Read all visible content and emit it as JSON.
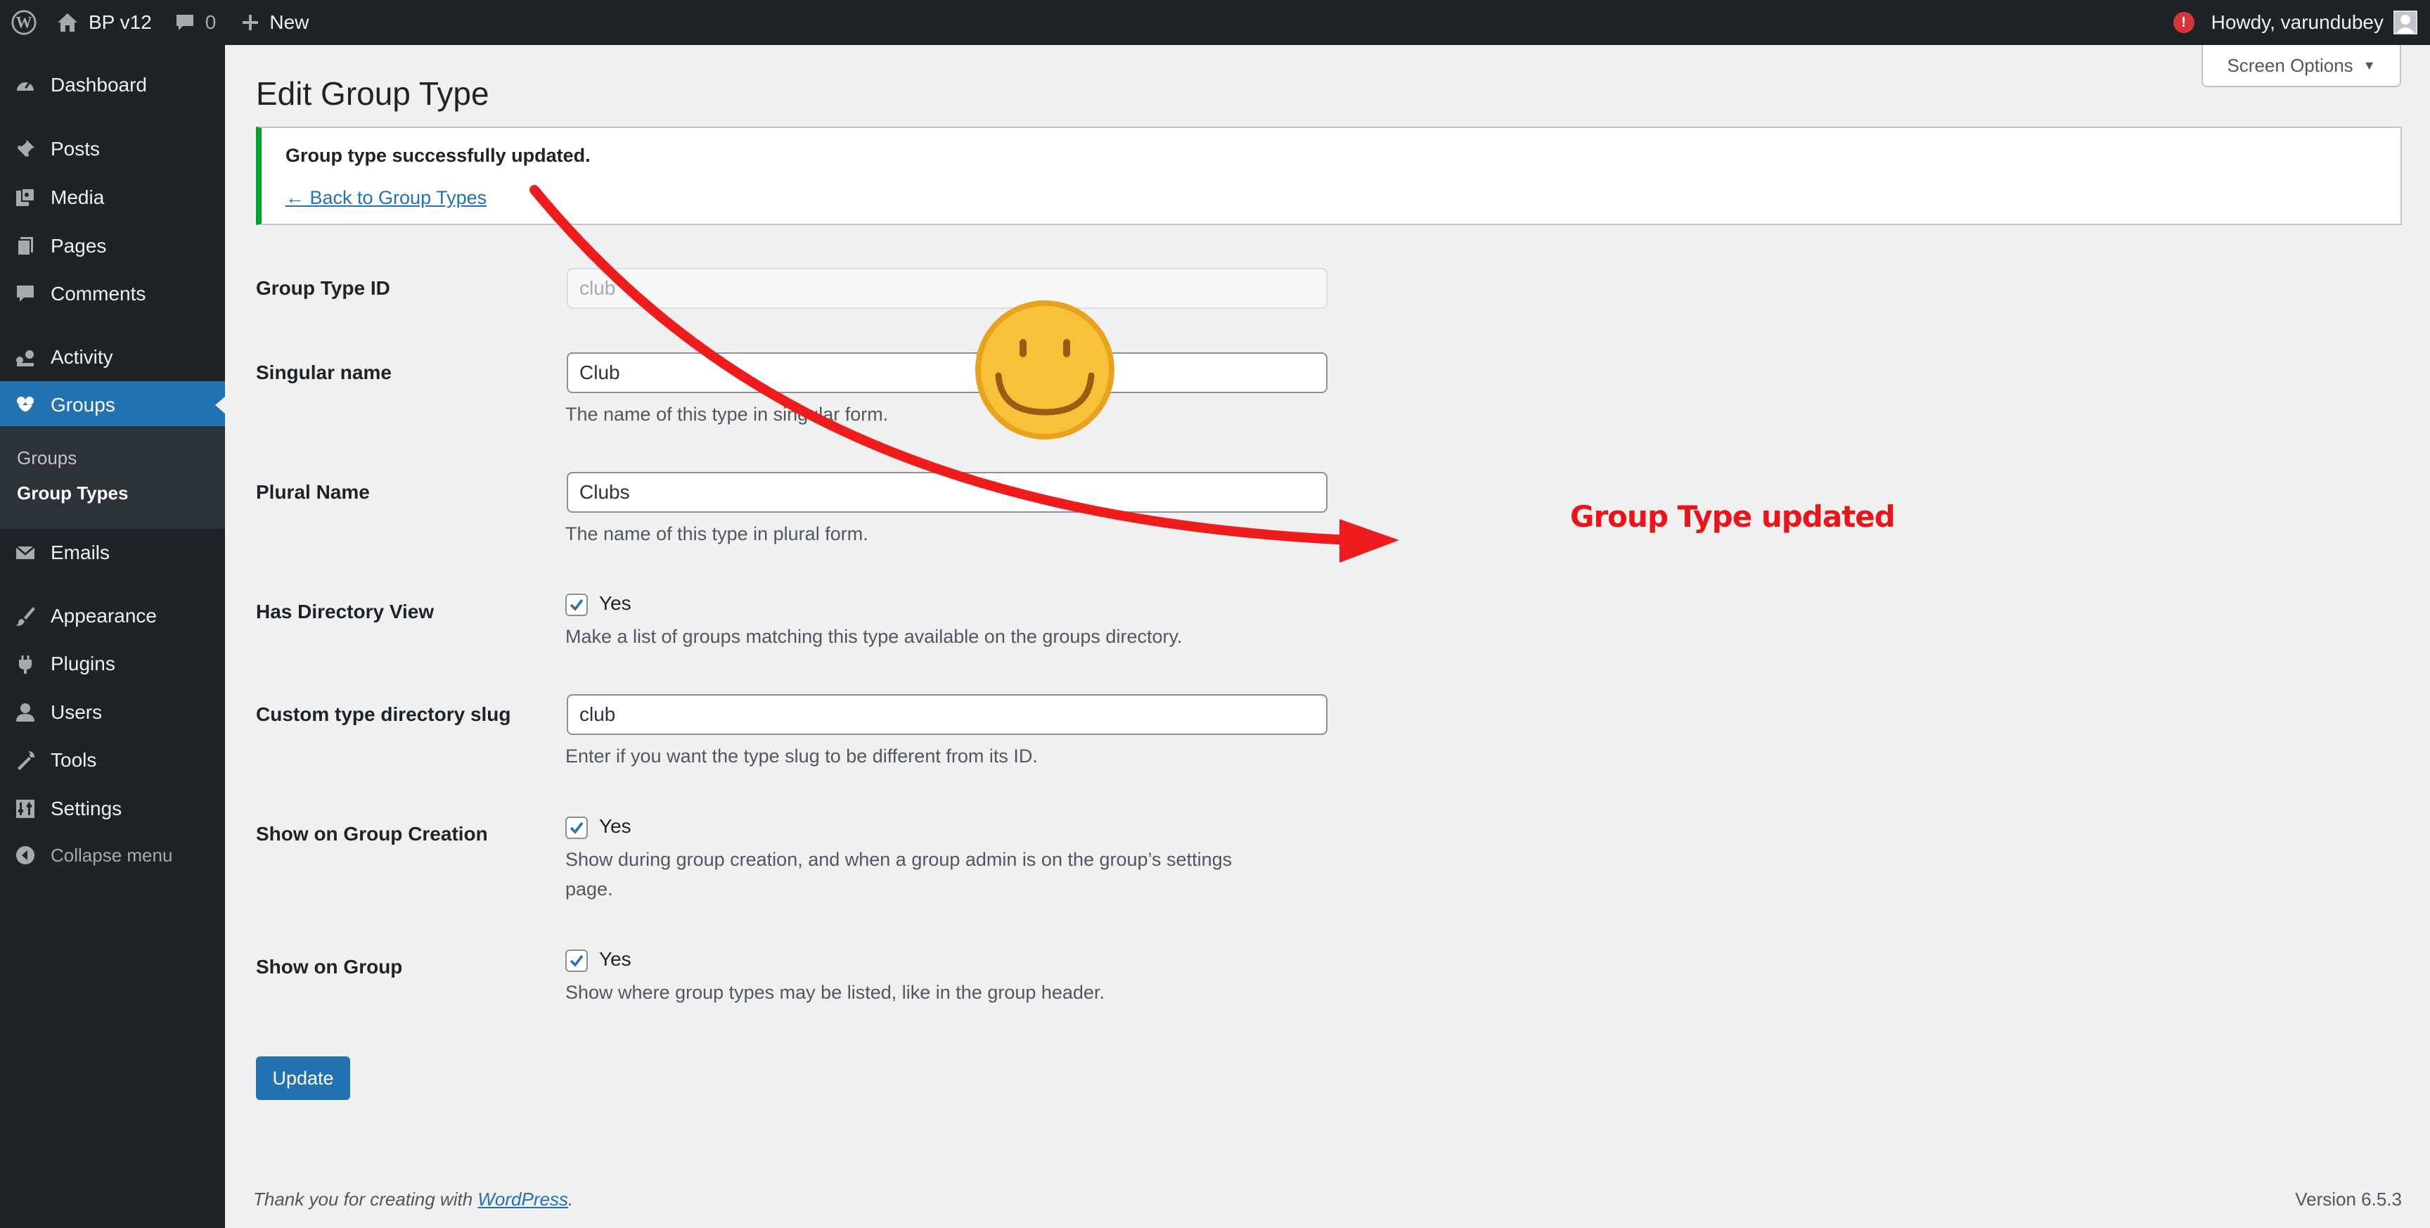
{
  "admin_bar": {
    "site_name": "BP v12",
    "comment_count": "0",
    "new_label": "New",
    "howdy": "Howdy, varundubey",
    "alert_glyph": "!"
  },
  "sidebar": {
    "items": [
      {
        "label": "Dashboard",
        "icon": "dashboard-icon"
      },
      {
        "label": "Posts",
        "icon": "pushpin-icon"
      },
      {
        "label": "Media",
        "icon": "media-icon"
      },
      {
        "label": "Pages",
        "icon": "pages-icon"
      },
      {
        "label": "Comments",
        "icon": "comment-icon"
      },
      {
        "label": "Activity",
        "icon": "activity-icon"
      },
      {
        "label": "Groups",
        "icon": "groups-icon",
        "current": true
      },
      {
        "label": "Emails",
        "icon": "mail-icon"
      },
      {
        "label": "Appearance",
        "icon": "paintbrush-icon"
      },
      {
        "label": "Plugins",
        "icon": "plugin-icon"
      },
      {
        "label": "Users",
        "icon": "user-icon"
      },
      {
        "label": "Tools",
        "icon": "wrench-icon"
      },
      {
        "label": "Settings",
        "icon": "settings-icon"
      }
    ],
    "submenu": [
      "Groups",
      "Group Types"
    ],
    "collapse_label": "Collapse menu"
  },
  "screen_options": "Screen Options",
  "page_title": "Edit Group Type",
  "notice": {
    "message": "Group type successfully updated.",
    "back_link": "← Back to Group Types"
  },
  "form": {
    "group_type_id": {
      "label": "Group Type ID",
      "value": "club"
    },
    "singular_name": {
      "label": "Singular name",
      "value": "Club",
      "description": "The name of this type in singular form."
    },
    "plural_name": {
      "label": "Plural Name",
      "value": "Clubs",
      "description": "The name of this type in plural form."
    },
    "has_directory_view": {
      "label": "Has Directory View",
      "checkbox_label": "Yes",
      "checked": true,
      "description": "Make a list of groups matching this type available on the groups directory."
    },
    "directory_slug": {
      "label": "Custom type directory slug",
      "value": "club",
      "description": "Enter if you want the type slug to be different from its ID."
    },
    "show_on_creation": {
      "label": "Show on Group Creation",
      "checkbox_label": "Yes",
      "checked": true,
      "description_line1": "Show during group creation, and when a group admin is on the group’s settings",
      "description_line2": "page."
    },
    "show_on_group": {
      "label": "Show on Group",
      "checkbox_label": "Yes",
      "checked": true,
      "description": "Show where group types may be listed, like in the group header."
    }
  },
  "update_button": "Update",
  "footer": {
    "thanks_prefix": "Thank you for creating with ",
    "wordpress_link": "WordPress",
    "thanks_suffix": ".",
    "version": "Version 6.5.3"
  },
  "annotation": {
    "text": "Group Type updated"
  },
  "colors": {
    "admin_bg": "#1d2327",
    "accent": "#2271b1",
    "success": "#00a32a",
    "annotation_red": "#e8151b",
    "smiley_yellow": "#f7c23a"
  }
}
